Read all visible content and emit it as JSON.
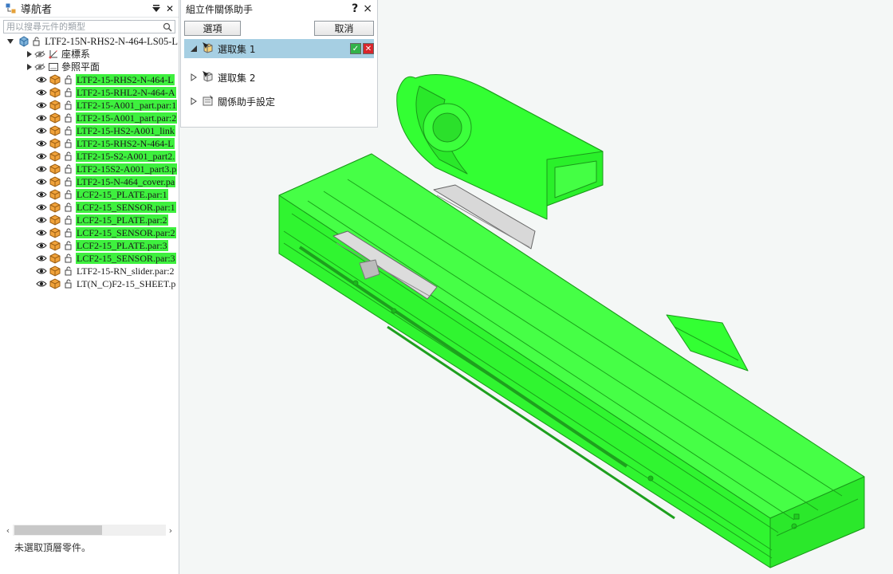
{
  "navigator": {
    "title": "導航者",
    "search_placeholder": "用以搜尋元件的類型",
    "root_label": "LTF2-15N-RHS2-N-464-LS05-L",
    "folders": [
      {
        "label": "座標系",
        "icon": "coordinate-system-icon"
      },
      {
        "label": "參照平面",
        "icon": "reference-plane-icon"
      }
    ],
    "parts": [
      {
        "label": "LTF2-15-RHS2-N-464-L",
        "highlighted": true
      },
      {
        "label": "LTF2-15-RHL2-N-464-A",
        "highlighted": true
      },
      {
        "label": "LTF2-15-A001_part.par:1",
        "highlighted": true
      },
      {
        "label": "LTF2-15-A001_part.par:2",
        "highlighted": true
      },
      {
        "label": "LTF2-15-HS2-A001_link",
        "highlighted": true
      },
      {
        "label": "LTF2-15-RHS2-N-464-L",
        "highlighted": true
      },
      {
        "label": "LTF2-15-S2-A001_part2.",
        "highlighted": true
      },
      {
        "label": "LTF2-15S2-A001_part3.p",
        "highlighted": true
      },
      {
        "label": "LTF2-15-N-464_cover.pa",
        "highlighted": true
      },
      {
        "label": "LCF2-15_PLATE.par:1",
        "highlighted": true
      },
      {
        "label": "LCF2-15_SENSOR.par:1",
        "highlighted": true
      },
      {
        "label": "LCF2-15_PLATE.par:2",
        "highlighted": true
      },
      {
        "label": "LCF2-15_SENSOR.par:2",
        "highlighted": true
      },
      {
        "label": "LCF2-15_PLATE.par:3",
        "highlighted": true
      },
      {
        "label": "LCF2-15_SENSOR.par:3",
        "highlighted": true
      },
      {
        "label": "LTF2-15-RN_slider.par:2",
        "highlighted": false
      },
      {
        "label": "LT(N_C)F2-15_SHEET.p",
        "highlighted": false
      }
    ],
    "status": "未選取頂層零件。"
  },
  "assistant": {
    "title": "組立件關係助手",
    "help_label": "?",
    "close_label": "×",
    "options_label": "選項",
    "cancel_label": "取消",
    "set1_label": "選取集 1",
    "set2_label": "選取集 2",
    "settings_label": "關係助手設定"
  },
  "colors": {
    "highlight": "#3ef03e",
    "selection_bar": "#a6cfe3",
    "model_green": "#33ff33",
    "background": "#f4f7f6"
  }
}
